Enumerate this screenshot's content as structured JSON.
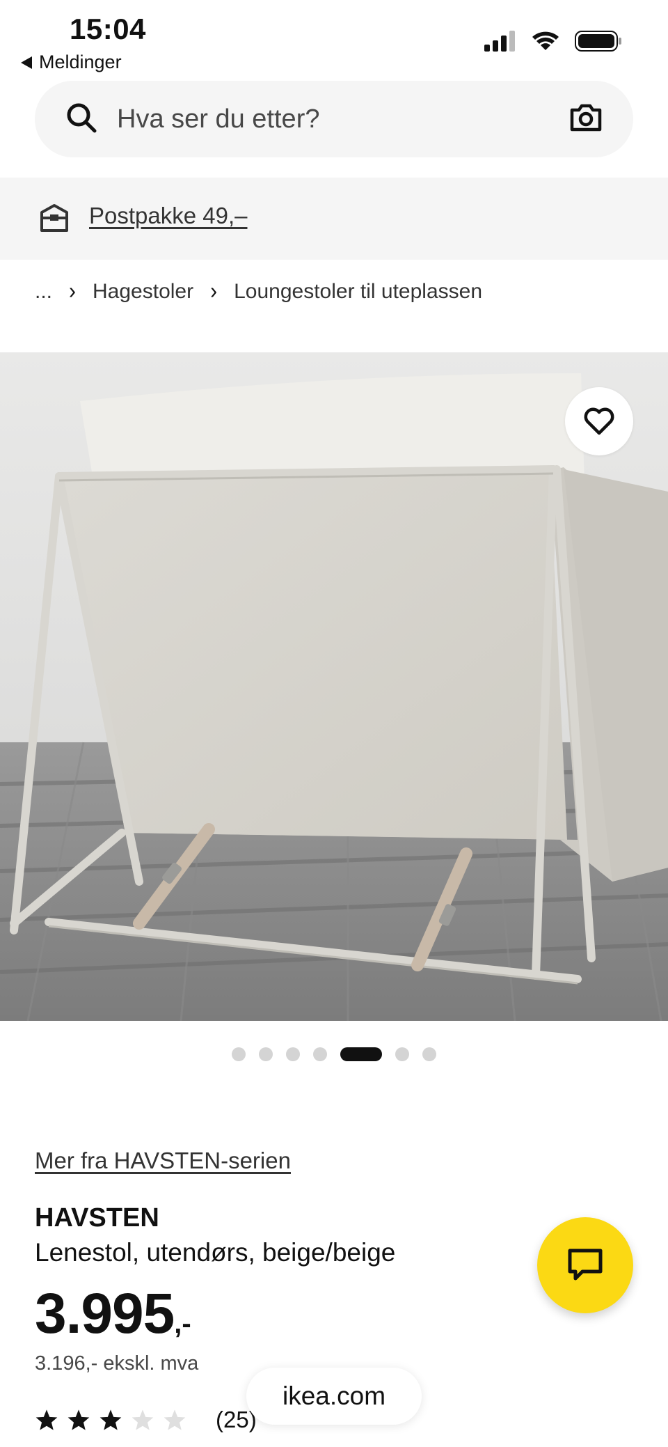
{
  "status_bar": {
    "time": "15:04",
    "back_label": "Meldinger"
  },
  "search": {
    "placeholder": "Hva ser du etter?"
  },
  "banner": {
    "link": "Postpakke 49,–"
  },
  "breadcrumb": {
    "ellipsis": "...",
    "items": [
      "Hagestoler",
      "Loungestoler til uteplassen"
    ]
  },
  "gallery": {
    "total_images": 7,
    "active_index": 4
  },
  "product": {
    "series_link": "Mer fra HAVSTEN-serien",
    "name": "HAVSTEN",
    "description": "Lenestol, utendørs, beige/beige",
    "price": "3.995",
    "price_suffix": ",-",
    "price_ex_vat": "3.196,- ekskl. mva",
    "rating": {
      "value": 3,
      "max": 5,
      "count": "(25)"
    }
  },
  "browser": {
    "url": "ikea.com"
  },
  "colors": {
    "chat_button": "#fbd914",
    "banner_bg": "#f5f5f5",
    "text": "#111111"
  },
  "icons": [
    "search-icon",
    "camera-icon",
    "delivery-box-icon",
    "heart-icon",
    "chat-icon",
    "star-icon",
    "signal-icon",
    "wifi-icon",
    "battery-icon"
  ]
}
